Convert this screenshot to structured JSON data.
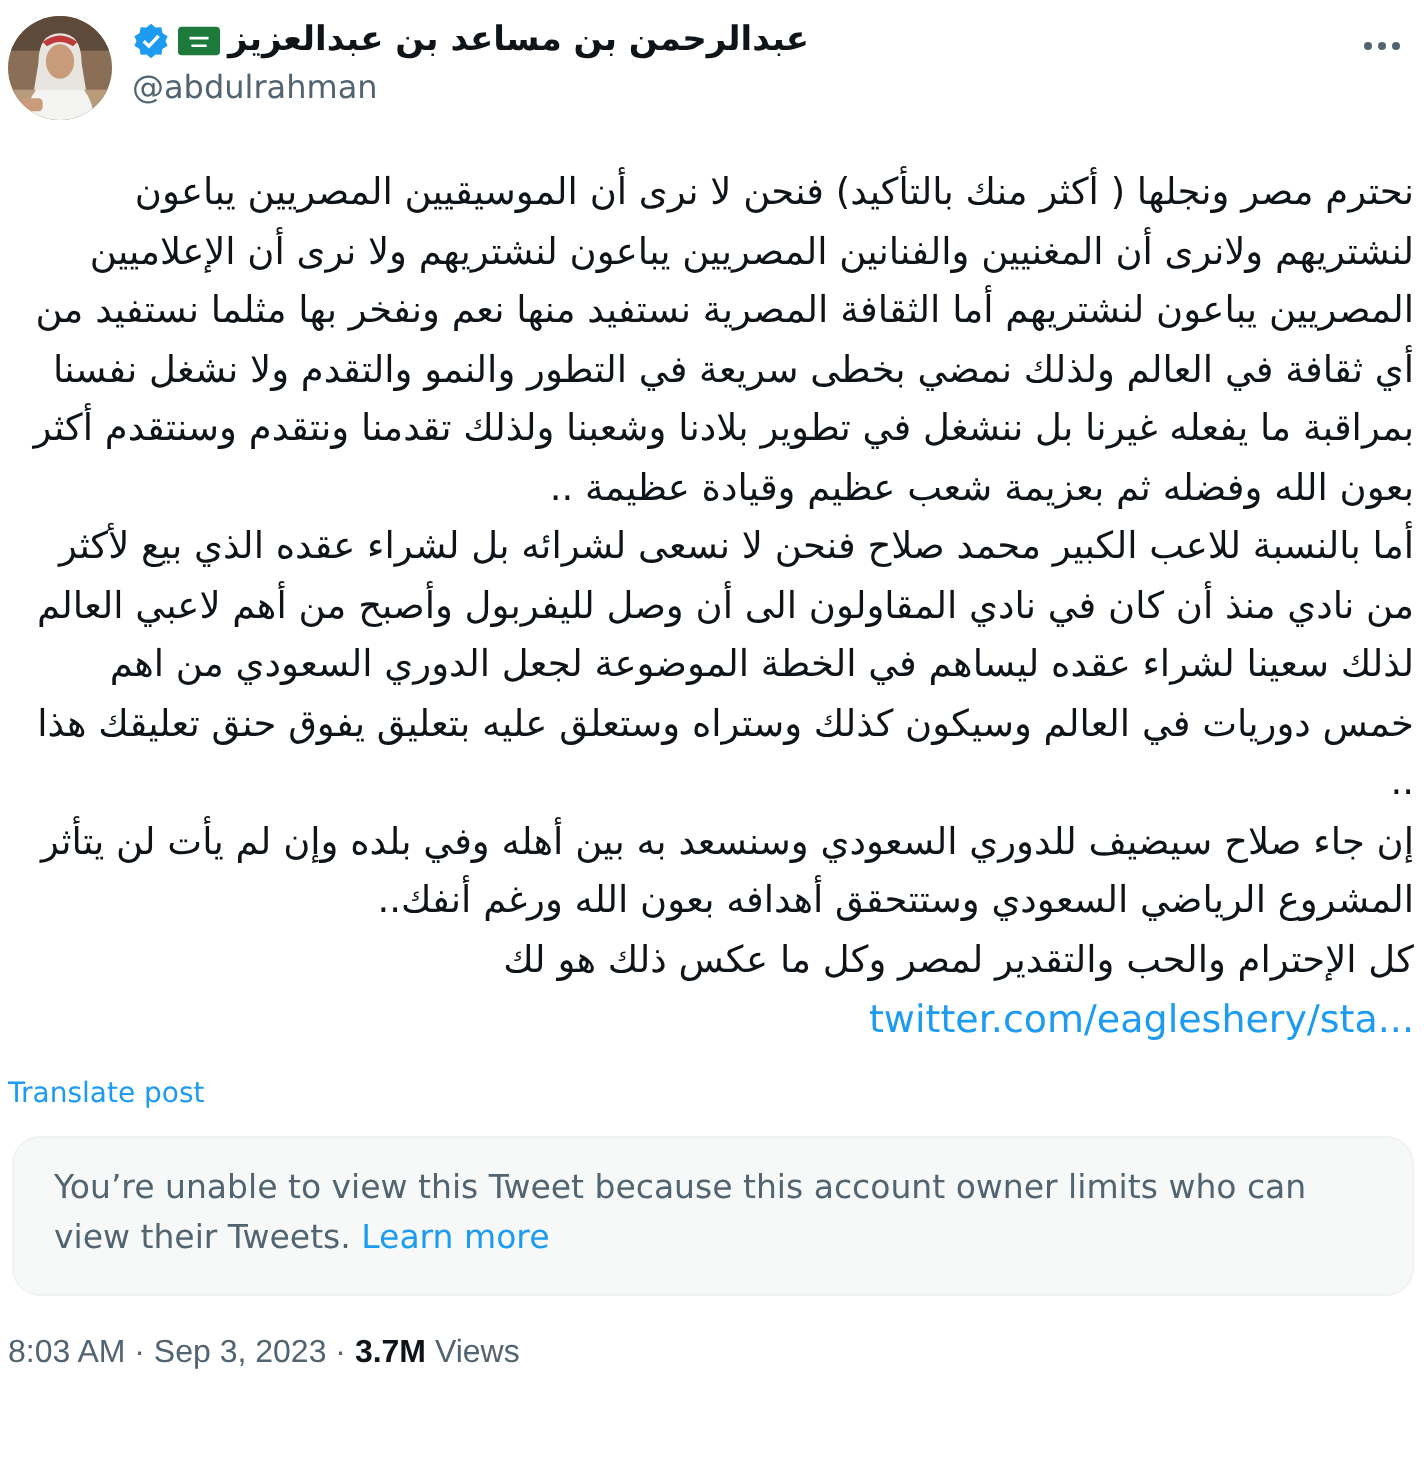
{
  "author": {
    "name": "عبدالرحمن بن مساعد بن عبدالعزيز",
    "handle": "@abdulrahman",
    "verified": true
  },
  "body": {
    "paragraphs": [
      "نحترم مصر ونجلها ( أكثر منك بالتأكيد) فنحن لا نرى أن الموسيقيين المصريين يباعون لنشتريهم ولانرى أن المغنيين والفنانين المصريين يباعون لنشتريهم ولا نرى أن الإعلاميين المصريين يباعون لنشتريهم أما الثقافة المصرية نستفيد منها نعم ونفخر بها مثلما نستفيد من أي ثقافة في العالم ولذلك نمضي بخطى سريعة في التطور والنمو والتقدم ولا نشغل نفسنا بمراقبة ما يفعله غيرنا بل ننشغل في تطوير بلادنا وشعبنا ولذلك تقدمنا ونتقدم وسنتقدم أكثر بعون الله وفضله ثم بعزيمة شعب عظيم وقيادة عظيمة ..",
      "أما بالنسبة للاعب الكبير محمد صلاح فنحن لا نسعى لشرائه بل لشراء عقده الذي بيع لأكثر من نادي منذ أن كان في نادي المقاولون الى أن وصل لليفربول وأصبح من أهم لاعبي العالم لذلك سعينا لشراء عقده ليساهم في الخطة الموضوعة لجعل الدوري السعودي من اهم خمس دوريات في العالم وسيكون كذلك وستراه وستعلق عليه بتعليق يفوق حنق تعليقك هذا ..",
      "إن جاء صلاح سيضيف للدوري السعودي وسنسعد به بين أهله وفي بلده وإن لم يأت لن يتأثر المشروع الرياضي السعودي وستتحقق أهدافه بعون الله ورغم أنفك..",
      "كل الإحترام والحب والتقدير لمصر وكل ما عكس ذلك هو لك"
    ],
    "link": "twitter.com/eagleshery/sta..."
  },
  "translate": "Translate post",
  "notice": {
    "text": "You’re unable to view this Tweet because this account owner limits who can view their Tweets.",
    "link": "Learn more"
  },
  "meta": "8:03 AM · Sep 3, 2023 · **3.7M** Views"
}
